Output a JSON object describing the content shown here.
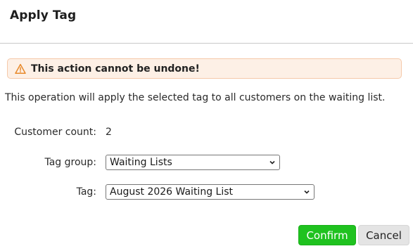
{
  "dialog": {
    "title": "Apply Tag",
    "warning": {
      "icon": "warning-triangle-icon",
      "text": "This action cannot be undone!",
      "background": "#fdf0e6",
      "border": "#f5c9a9"
    },
    "description": "This operation will apply the selected tag to all customers on the waiting list.",
    "customer_count": {
      "label": "Customer count:",
      "value": "2"
    },
    "tag_group": {
      "label": "Tag group:",
      "selected": "Waiting Lists"
    },
    "tag": {
      "label": "Tag:",
      "selected": "August 2026 Waiting List"
    },
    "buttons": {
      "confirm": "Confirm",
      "cancel": "Cancel",
      "confirm_color": "#1fc21f"
    }
  }
}
